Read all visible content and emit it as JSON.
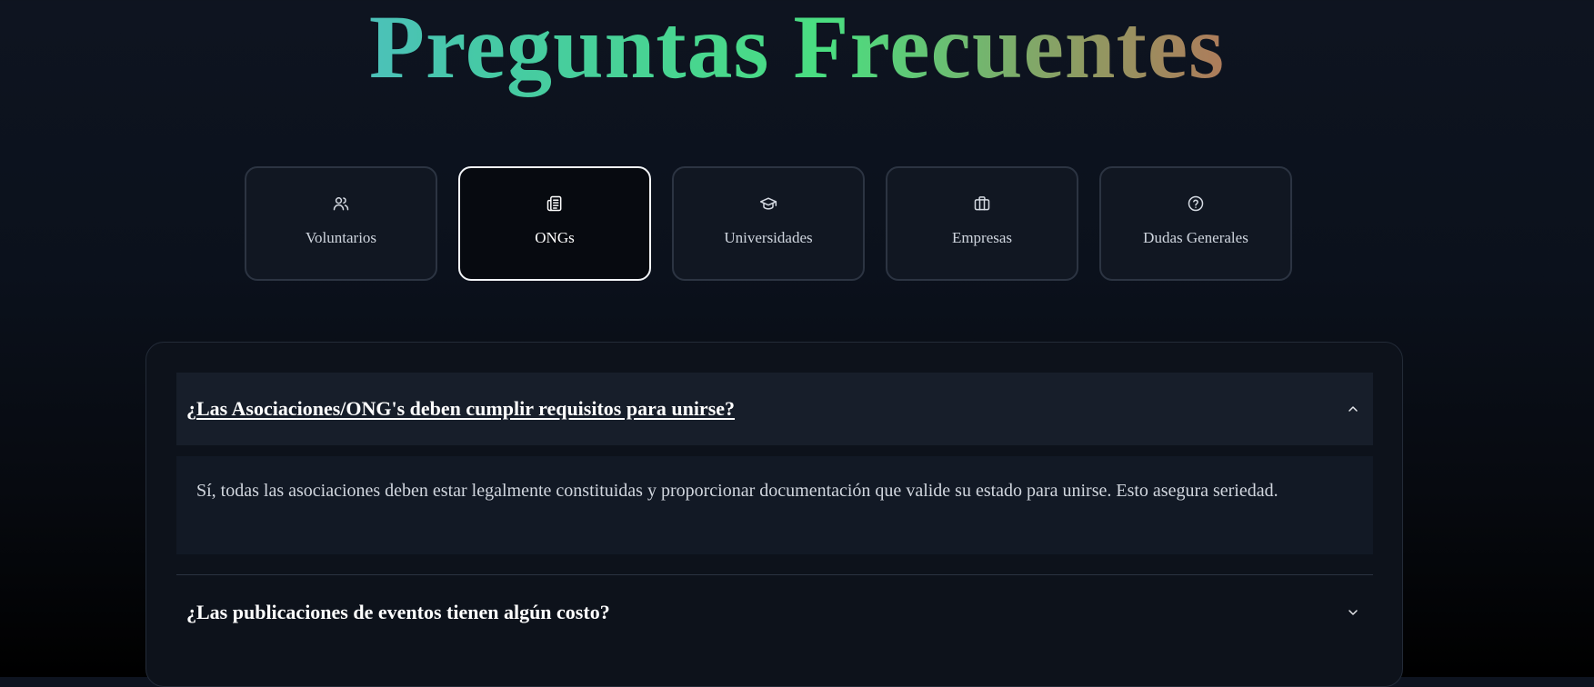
{
  "page": {
    "title": "Preguntas Frecuentes"
  },
  "tabs": [
    {
      "label": "Voluntarios",
      "icon": "users-icon",
      "active": false
    },
    {
      "label": "ONGs",
      "icon": "newspaper-icon",
      "active": true
    },
    {
      "label": "Universidades",
      "icon": "graduation-cap-icon",
      "active": false
    },
    {
      "label": "Empresas",
      "icon": "briefcase-icon",
      "active": false
    },
    {
      "label": "Dudas Generales",
      "icon": "help-circle-icon",
      "active": false
    }
  ],
  "faq": {
    "items": [
      {
        "question_prefix": "¿",
        "question_link": "Las Asociaciones/ONG's deben cumplir requisitos para unirse?",
        "expanded": true,
        "answer": "Sí, todas las asociaciones deben estar legalmente constituidas y proporcionar documentación que valide su estado para unirse. Esto asegura seriedad."
      },
      {
        "question": "¿Las publicaciones de eventos tienen algún costo?",
        "expanded": false
      }
    ]
  },
  "colors": {
    "title_gradient": [
      "#60a5fa",
      "#46c9a6",
      "#4ade80",
      "#8f9a62",
      "#c06a56",
      "#ef4444"
    ],
    "active_tab_border": "#f2f4f7",
    "panel_bg": "#0d121b"
  }
}
